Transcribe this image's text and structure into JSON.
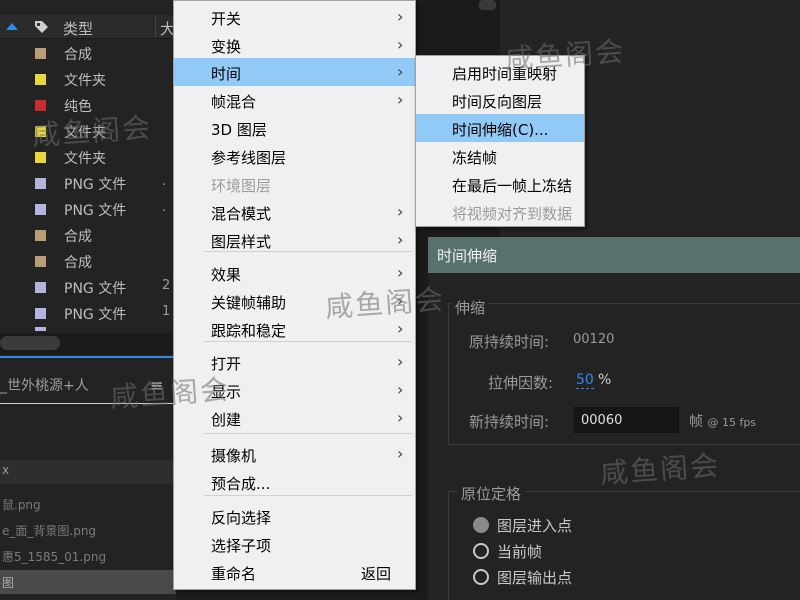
{
  "project_panel": {
    "column_type": "类型",
    "column_next": "大",
    "rows": [
      {
        "type": "合成",
        "color": "#b89e74",
        "extra": ""
      },
      {
        "type": "文件夹",
        "color": "#e8d63a",
        "extra": ""
      },
      {
        "type": "纯色",
        "color": "#c62e2e",
        "extra": ""
      },
      {
        "type": "文件夹",
        "color": "#e8d63a",
        "extra": ""
      },
      {
        "type": "文件夹",
        "color": "#e8d63a",
        "extra": ""
      },
      {
        "type": "PNG 文件",
        "color": "#b4b4de",
        "extra": "."
      },
      {
        "type": "PNG 文件",
        "color": "#b4b4de",
        "extra": "."
      },
      {
        "type": "合成",
        "color": "#b89e74",
        "extra": ""
      },
      {
        "type": "合成",
        "color": "#b89e74",
        "extra": ""
      },
      {
        "type": "PNG 文件",
        "color": "#b4b4de",
        "extra": "2"
      },
      {
        "type": "PNG 文件",
        "color": "#b4b4de",
        "extra": "1"
      },
      {
        "type": "",
        "color": "#b4b4de",
        "extra": ""
      }
    ],
    "comp_tab_label": "_世外桃源+人",
    "comp_menu_glyph": "≡",
    "close_glyph": "x",
    "lower_files": [
      "鼠.png",
      "e_面_背景图.png",
      "惠5_1585_01.png",
      "图"
    ]
  },
  "context_menu": {
    "items": [
      {
        "label": "开关",
        "submenu": true
      },
      {
        "label": "变换",
        "submenu": true
      },
      {
        "label": "时间",
        "submenu": true,
        "active": true
      },
      {
        "label": "帧混合",
        "submenu": true
      },
      {
        "label": "3D 图层"
      },
      {
        "label": "参考线图层"
      },
      {
        "label": "环境图层",
        "disabled": true
      },
      {
        "label": "混合模式",
        "submenu": true
      },
      {
        "label": "图层样式",
        "submenu": true
      },
      {
        "label": "效果",
        "submenu": true
      },
      {
        "label": "关键帧辅助",
        "submenu": true
      },
      {
        "label": "跟踪和稳定",
        "submenu": true
      },
      {
        "label": "打开",
        "submenu": true
      },
      {
        "label": "显示",
        "submenu": true
      },
      {
        "label": "创建",
        "submenu": true
      },
      {
        "label": "摄像机",
        "submenu": true
      },
      {
        "label": "预合成..."
      },
      {
        "label": "反向选择"
      },
      {
        "label": "选择子项"
      },
      {
        "label": "重命名",
        "shortcut": "返回"
      }
    ],
    "arrow_glyph": "›"
  },
  "time_submenu": {
    "items": [
      {
        "label": "启用时间重映射"
      },
      {
        "label": "时间反向图层"
      },
      {
        "label": "时间伸缩(C)...",
        "active": true
      },
      {
        "label": "冻结帧"
      },
      {
        "label": "在最后一帧上冻结"
      },
      {
        "label": "将视频对齐到数据",
        "disabled": true
      }
    ]
  },
  "time_stretch_dialog": {
    "title": "时间伸缩",
    "stretch_group": "伸缩",
    "original_duration_label": "原持续时间:",
    "original_duration_value": "00120",
    "stretch_factor_label": "拉伸因数:",
    "stretch_factor_value": "50",
    "stretch_factor_unit": "%",
    "new_duration_label": "新持续时间:",
    "new_duration_value": "00060",
    "new_duration_unit": "帧",
    "fps_note": "@ 15 fps",
    "hold_group": "原位定格",
    "hold_options": [
      {
        "label": "图层进入点",
        "checked": true
      },
      {
        "label": "当前帧",
        "checked": false
      },
      {
        "label": "图层输出点",
        "checked": false
      }
    ]
  },
  "watermark_text": "咸鱼阁会"
}
